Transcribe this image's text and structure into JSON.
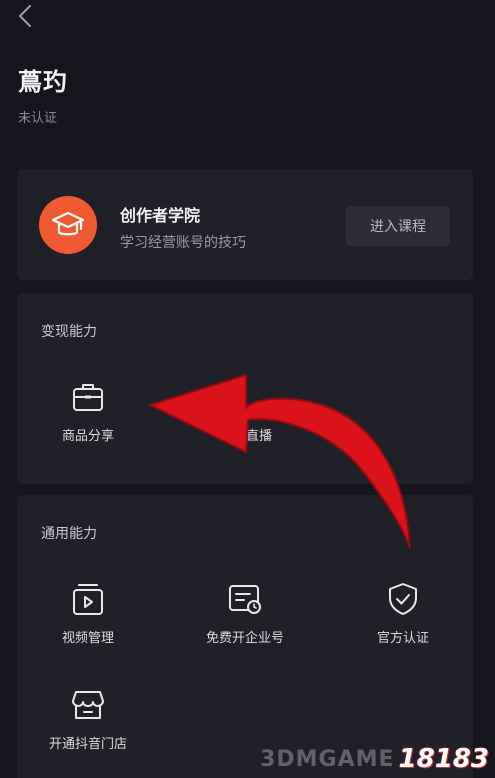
{
  "header": {
    "title": "蔦玓",
    "subtitle": "未认证"
  },
  "academy": {
    "title": "创作者学院",
    "description": "学习经营账号的技巧",
    "enter_label": "进入课程",
    "icon": "graduation-cap-icon",
    "accent": "#f05a31"
  },
  "monetization": {
    "title": "变现能力",
    "items": [
      {
        "label": "商品分享",
        "icon": "briefcase-icon"
      },
      {
        "label": "直播",
        "icon": "live-icon"
      }
    ]
  },
  "general": {
    "title": "通用能力",
    "items": [
      {
        "label": "视频管理",
        "icon": "video-folder-icon"
      },
      {
        "label": "免费开企业号",
        "icon": "enterprise-card-icon"
      },
      {
        "label": "官方认证",
        "icon": "shield-check-icon"
      },
      {
        "label": "开通抖音门店",
        "icon": "store-icon"
      }
    ]
  },
  "overlay": {
    "arrow_color": "#e3121b"
  },
  "watermark": {
    "logo": "18183",
    "text": "3DMGAME"
  }
}
